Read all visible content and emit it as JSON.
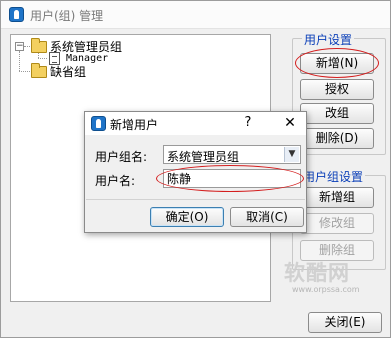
{
  "window": {
    "title": "用户(组) 管理"
  },
  "tree": {
    "expander": "−",
    "items": [
      {
        "label": "系统管理员组",
        "type": "folder"
      },
      {
        "label": "Manager",
        "type": "user"
      },
      {
        "label": "缺省组",
        "type": "folder"
      }
    ]
  },
  "user_settings": {
    "title": "用户设置",
    "buttons": {
      "add": "新增(N)",
      "authorize": "授权",
      "edit": "改组",
      "delete": "删除(D)"
    }
  },
  "group_settings": {
    "title": "用户组设置",
    "buttons": {
      "add": "新增组",
      "edit": "修改组",
      "delete": "删除组"
    }
  },
  "close_button": "关闭(E)",
  "dialog": {
    "title": "新增用户",
    "help": "?",
    "close": "✕",
    "group_label": "用户组名:",
    "group_value": "系统管理员组",
    "name_label": "用户名:",
    "name_value": "陈静",
    "ok": "确定(O)",
    "cancel": "取消(C)"
  },
  "watermark": {
    "brand": "软酷网",
    "url": "www.orpssa.com"
  },
  "colors": {
    "legend": "#0b3fb8",
    "highlight": "#d41e1e",
    "app_icon": "#1f74c8"
  }
}
